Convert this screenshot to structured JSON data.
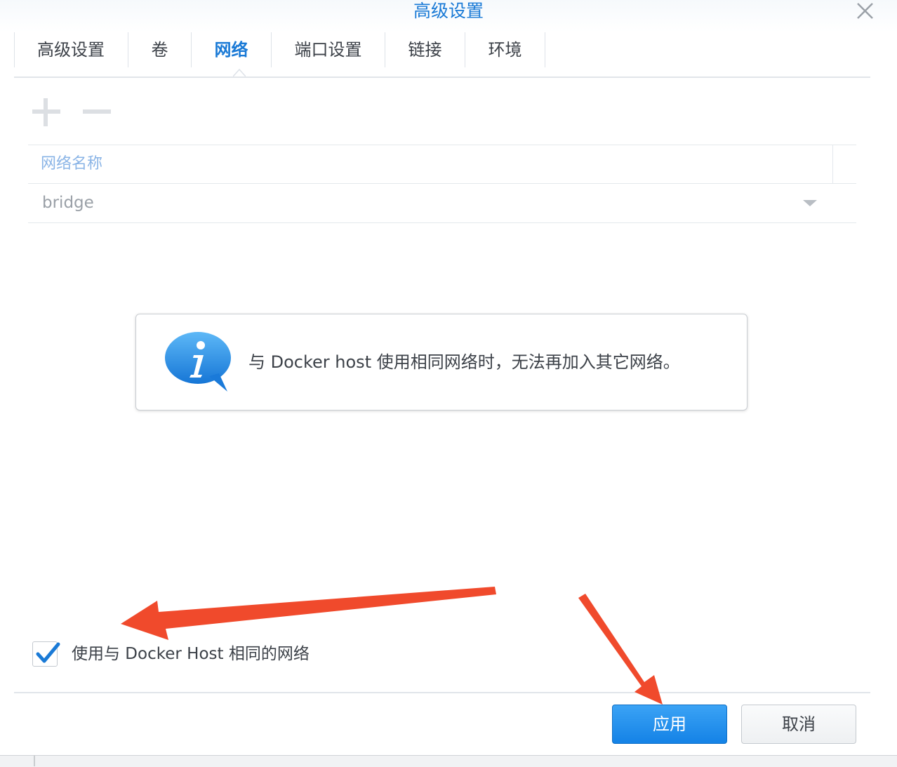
{
  "window": {
    "title": "高级设置"
  },
  "tabs": [
    {
      "label": "高级设置",
      "active": false
    },
    {
      "label": "卷",
      "active": false
    },
    {
      "label": "网络",
      "active": true
    },
    {
      "label": "端口设置",
      "active": false
    },
    {
      "label": "链接",
      "active": false
    },
    {
      "label": "环境",
      "active": false
    }
  ],
  "toolbar": {
    "add_icon": "plus-icon",
    "remove_icon": "minus-icon"
  },
  "grid": {
    "column_header": "网络名称",
    "rows": [
      {
        "network_name": "bridge"
      }
    ]
  },
  "info": {
    "icon": "info-bubble-icon",
    "message": "与 Docker host 使用相同网络时，无法再加入其它网络。"
  },
  "options": {
    "use_host_network": {
      "label": "使用与 Docker Host 相同的网络",
      "checked": true
    }
  },
  "footer": {
    "apply_label": "应用",
    "cancel_label": "取消"
  },
  "colors": {
    "accent": "#1a7ad6",
    "primary_button": "#1e8ff0",
    "annotation_arrow": "#f04a2c"
  }
}
